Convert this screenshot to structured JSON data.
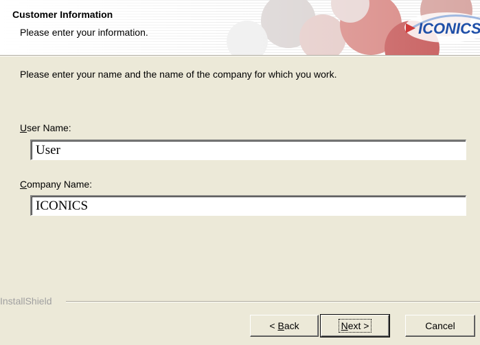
{
  "header": {
    "title": "Customer Information",
    "subtitle": "Please enter your information.",
    "logo_text": "ICONICS",
    "logo_color": "#1e4fa8",
    "accent_color": "#c83a3a"
  },
  "main": {
    "instruction": "Please enter your name and the name of the company for which you work.",
    "user_name": {
      "label_accel": "U",
      "label_rest": "ser Name:",
      "value": "User"
    },
    "company_name": {
      "label_accel": "C",
      "label_rest": "ompany Name:",
      "value": "ICONICS"
    }
  },
  "footer": {
    "brand": "InstallShield",
    "back": {
      "prefix": "< ",
      "accel": "B",
      "rest": "ack"
    },
    "next": {
      "accel": "N",
      "rest": "ext >"
    },
    "cancel": "Cancel"
  }
}
